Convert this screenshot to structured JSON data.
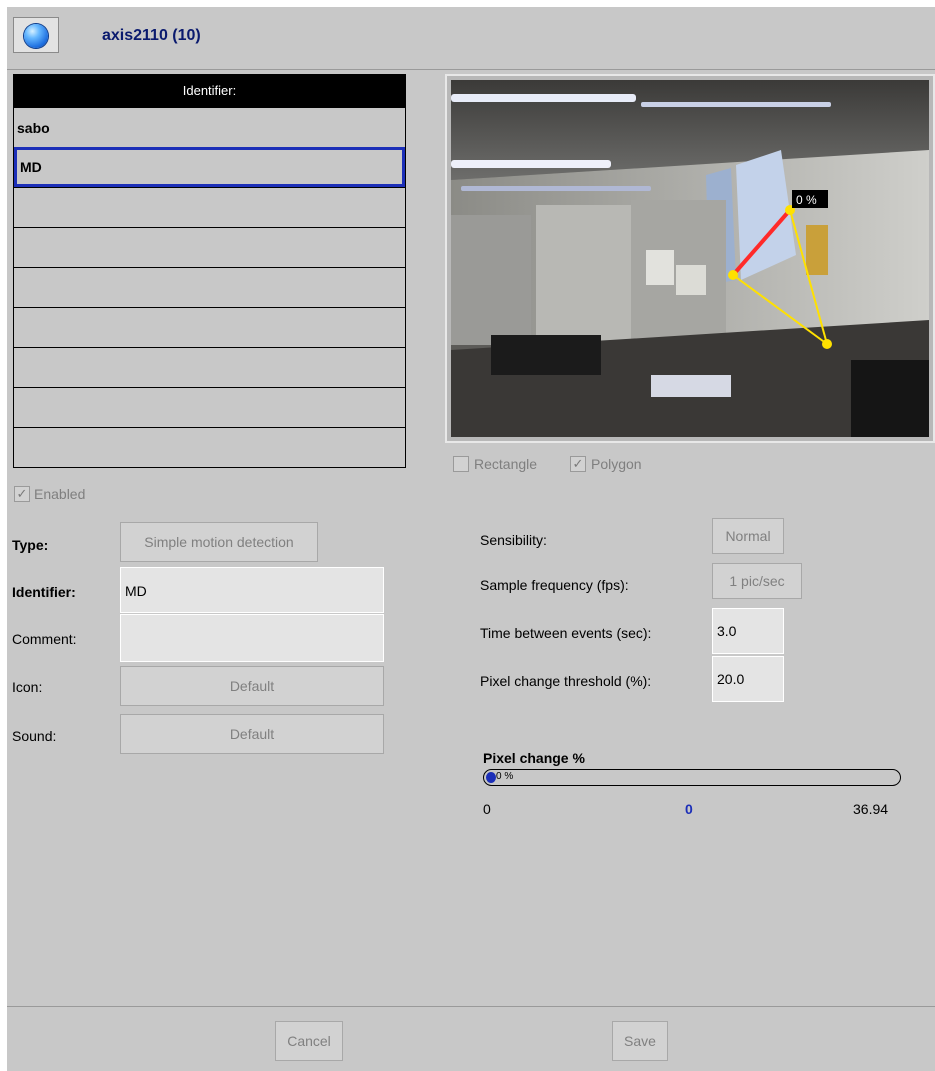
{
  "header": {
    "title": "axis2110 (10)",
    "icon": "globe-icon"
  },
  "identifier_list": {
    "header": "Identifier:",
    "rows": [
      "sabo",
      "MD",
      "",
      "",
      "",
      "",
      "",
      "",
      ""
    ],
    "selected_index": 1
  },
  "enabled": {
    "label": "Enabled",
    "checked": true
  },
  "form": {
    "type_label": "Type:",
    "type_value": "Simple motion detection",
    "identifier_label": "Identifier:",
    "identifier_value": "MD",
    "comment_label": "Comment:",
    "comment_value": "",
    "icon_label": "Icon:",
    "icon_value": "Default",
    "sound_label": "Sound:",
    "sound_value": "Default"
  },
  "camera": {
    "overlay_label": "0 %"
  },
  "shape": {
    "rectangle_label": "Rectangle",
    "rectangle_checked": false,
    "polygon_label": "Polygon",
    "polygon_checked": true
  },
  "settings": {
    "sensibility_label": "Sensibility:",
    "sensibility_value": "Normal",
    "sample_label": "Sample frequency (fps):",
    "sample_value": "1 pic/sec",
    "time_label": "Time between events (sec):",
    "time_value": "3.0",
    "threshold_label": "Pixel change threshold (%):",
    "threshold_value": "20.0"
  },
  "pixel_change": {
    "title": "Pixel change %",
    "bar_text": "0 %",
    "level": 0,
    "min": "0",
    "current": "0",
    "max": "36.94"
  },
  "footer": {
    "cancel": "Cancel",
    "save": "Save"
  },
  "colors": {
    "window_bg": "#c8c8c8",
    "accent": "#1c2fb8",
    "title": "#0a1a6e",
    "polygon": "#ffe100"
  }
}
